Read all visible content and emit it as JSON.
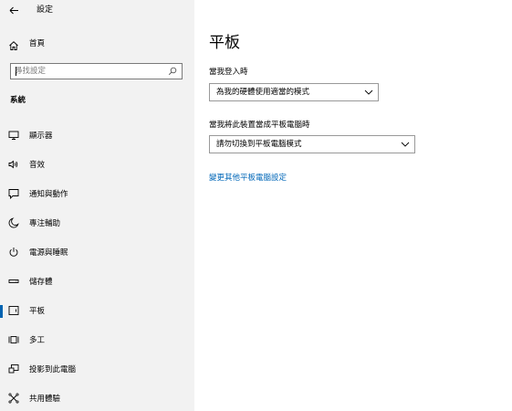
{
  "titlebar": {
    "app_title": "設定"
  },
  "sidebar": {
    "home_label": "首頁",
    "search_placeholder": "尋找設定",
    "section_header": "系統",
    "items": [
      {
        "label": "顯示器",
        "icon": "monitor-icon"
      },
      {
        "label": "音效",
        "icon": "speaker-icon"
      },
      {
        "label": "通知與動作",
        "icon": "notification-icon"
      },
      {
        "label": "專注輔助",
        "icon": "moon-icon"
      },
      {
        "label": "電源與睡眠",
        "icon": "power-icon"
      },
      {
        "label": "儲存體",
        "icon": "storage-icon"
      },
      {
        "label": "平板",
        "icon": "tablet-icon",
        "active": true
      },
      {
        "label": "多工",
        "icon": "multitask-icon"
      },
      {
        "label": "投影到此電腦",
        "icon": "project-icon"
      },
      {
        "label": "共用體驗",
        "icon": "shared-experience-icon"
      }
    ]
  },
  "main": {
    "title": "平板",
    "setting1": {
      "label": "當我登入時",
      "value": "為我的硬體使用適當的模式"
    },
    "setting2": {
      "label": "當我將此裝置當成平板電腦時",
      "value": "請勿切換到平板電腦模式"
    },
    "link": "變更其他平板電腦設定"
  },
  "colors": {
    "sidebar_bg": "#f2f2f2",
    "accent": "#0063b1",
    "link": "#0067b8",
    "border": "#999999"
  }
}
